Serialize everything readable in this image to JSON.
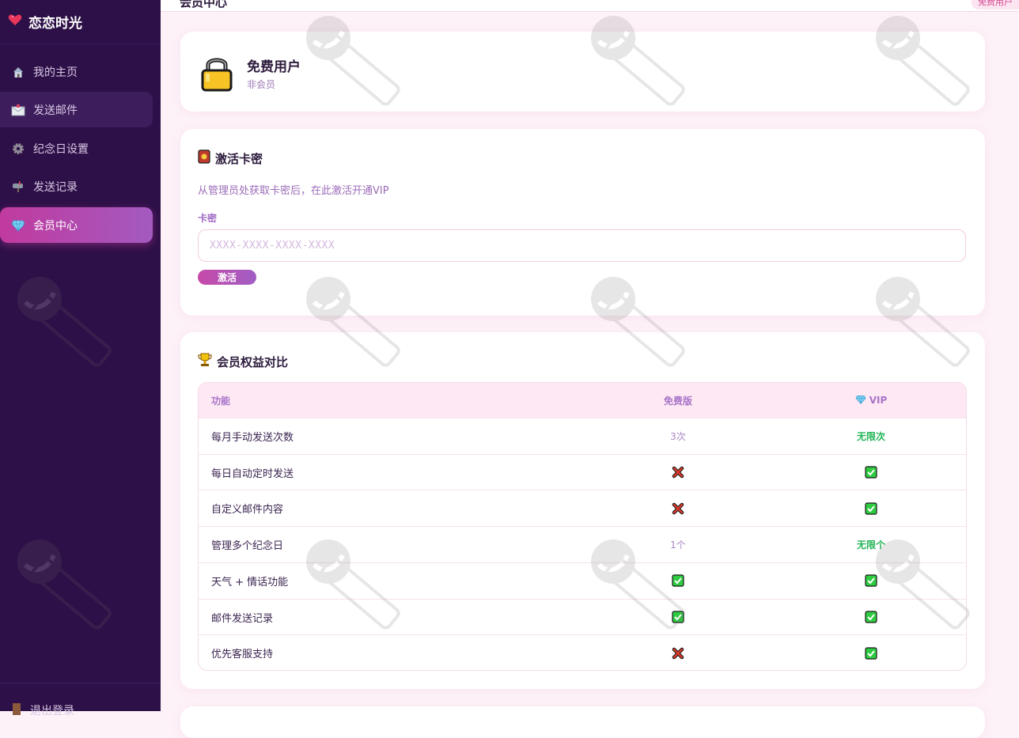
{
  "app": {
    "title": "恋恋时光"
  },
  "sidebar": {
    "items": [
      {
        "label": "我的主页",
        "icon": "house-icon"
      },
      {
        "label": "发送邮件",
        "icon": "mail-icon"
      },
      {
        "label": "纪念日设置",
        "icon": "gear-icon"
      },
      {
        "label": "发送记录",
        "icon": "mailbox-icon"
      },
      {
        "label": "会员中心",
        "icon": "diamond-icon"
      }
    ],
    "logout": "退出登录"
  },
  "header": {
    "title": "会员中心",
    "badge": "免费用户"
  },
  "user_card": {
    "name": "免费用户",
    "status": "非会员",
    "icon": "lock-icon"
  },
  "activate": {
    "title": "激活卡密",
    "icon": "card-icon",
    "description": "从管理员处获取卡密后，在此激活开通VIP",
    "field_label": "卡密",
    "placeholder": "XXXX-XXXX-XXXX-XXXX",
    "button": "激活"
  },
  "compare": {
    "title": "会员权益对比",
    "icon": "trophy-icon",
    "headers": {
      "feature": "功能",
      "free": "免费版",
      "vip": "VIP"
    },
    "rows": [
      {
        "feature": "每月手动发送次数",
        "free": "3次",
        "vip": "无限次"
      },
      {
        "feature": "每日自动定时发送",
        "free": "cross",
        "vip": "check"
      },
      {
        "feature": "自定义邮件内容",
        "free": "cross",
        "vip": "check"
      },
      {
        "feature": "管理多个纪念日",
        "free": "1个",
        "vip": "无限个"
      },
      {
        "feature": "天气 + 情话功能",
        "free": "check",
        "vip": "check"
      },
      {
        "feature": "邮件发送记录",
        "free": "check",
        "vip": "check"
      },
      {
        "feature": "优先客服支持",
        "free": "cross",
        "vip": "check"
      }
    ]
  },
  "colors": {
    "sidebar_bg": "#2e1048",
    "accent_gradient_start": "#c13a9e",
    "accent_gradient_end": "#a35ac0",
    "page_bg": "#fdf2f8",
    "vip_green": "#22b455"
  }
}
